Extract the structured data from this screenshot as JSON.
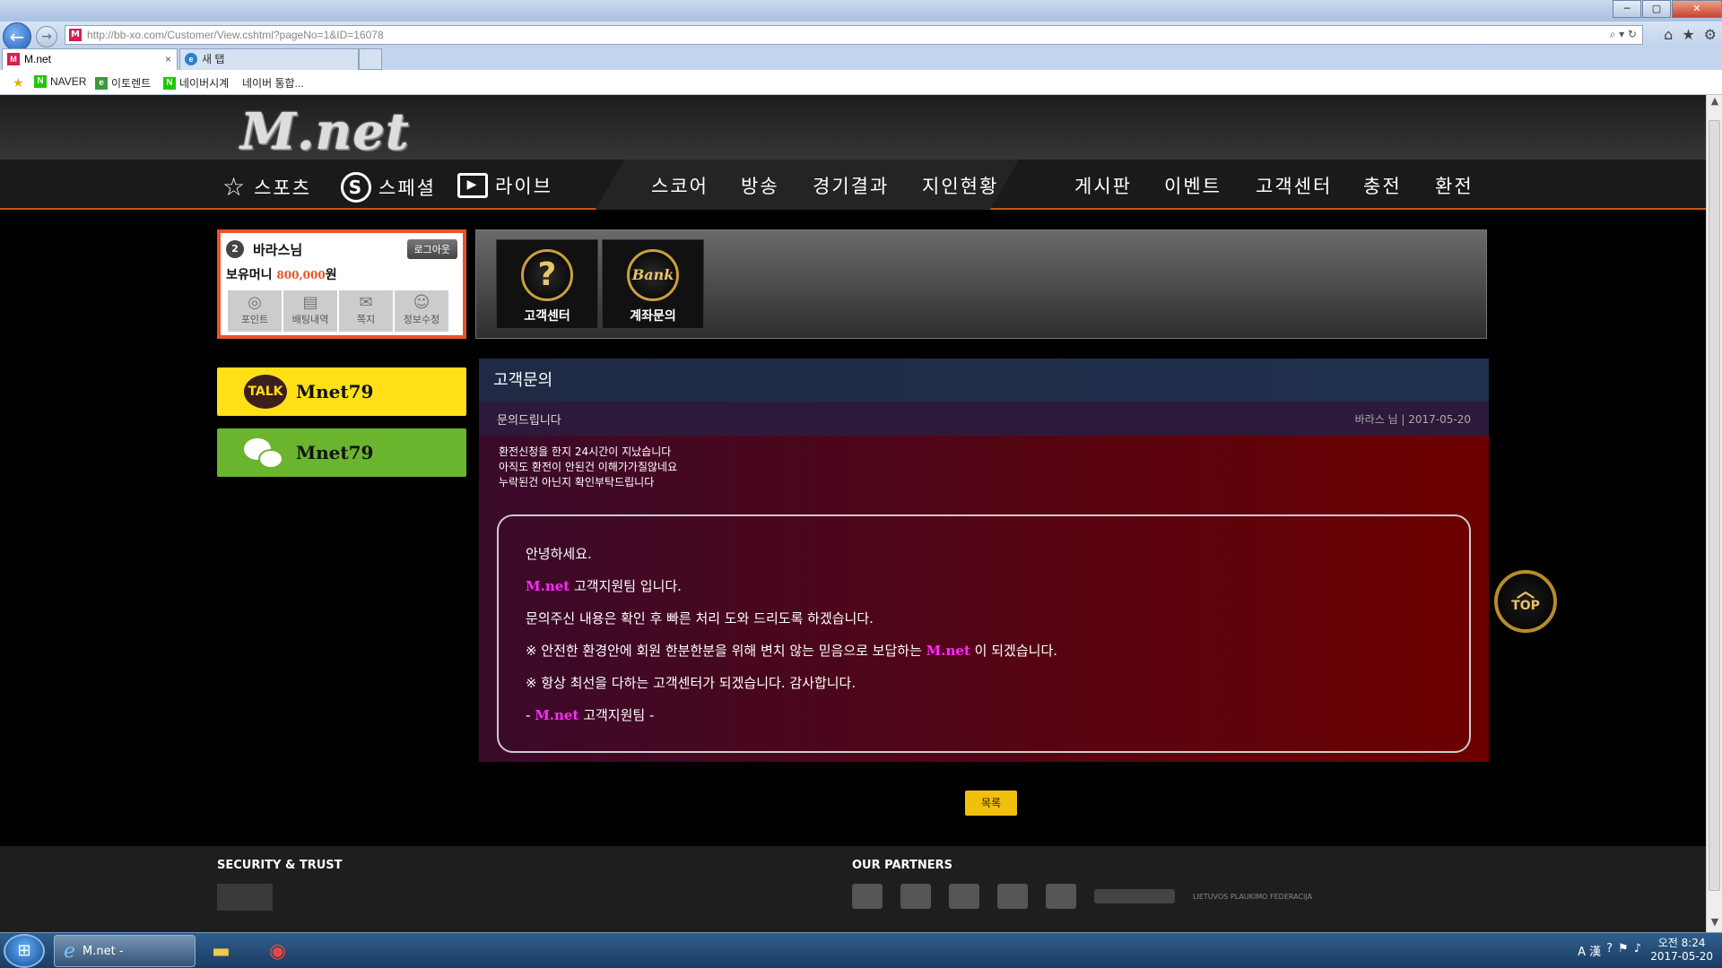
{
  "browser": {
    "url": "http://bb-xo.com/Customer/View.cshtml?pageNo=1&ID=16078",
    "tabs": [
      {
        "label": "M.net",
        "active": true
      },
      {
        "label": "새 탭",
        "active": false
      }
    ],
    "favorites": [
      "NAVER",
      "이토렌트",
      "네이버시계",
      "네이버 통합..."
    ],
    "window_buttons": [
      "─",
      "▢",
      "✕"
    ]
  },
  "site": {
    "logo": "M.net",
    "nav_left": [
      {
        "icon": "star-icon",
        "label": "스포츠"
      },
      {
        "icon": "special-s-icon",
        "label": "스페셜"
      },
      {
        "icon": "live-monitor-icon",
        "label": "라이브"
      }
    ],
    "nav_mid": [
      "스코어",
      "방송",
      "경기결과",
      "지인현황"
    ],
    "nav_right": [
      "게시판",
      "이벤트",
      "고객센터",
      "충전",
      "환전"
    ]
  },
  "user": {
    "name": "바라스님",
    "level": "2",
    "logout_label": "로그아웃",
    "money_label": "보유머니",
    "money_value": "800,000",
    "money_unit": "원",
    "buttons": [
      "포인트",
      "배팅내역",
      "쪽지",
      "정보수정"
    ]
  },
  "menu": [
    {
      "label": "고객센터",
      "glyph": "?"
    },
    {
      "label": "계좌문의",
      "glyph": "Bank"
    }
  ],
  "social": [
    {
      "icon": "kakaotalk-icon",
      "icon_text": "TALK",
      "label": "Mnet79"
    },
    {
      "icon": "wechat-icon",
      "label": "Mnet79"
    }
  ],
  "inquiry": {
    "section_title": "고객문의",
    "subject": "문의드립니다",
    "author_meta": "바라스 님 | 2017-05-20",
    "body_lines": [
      "환전신청을 한지 24시간이 지났습니다",
      "아직도 환전이 안된건 이해가가질않네요",
      "누락된건 아닌지 확인부탁드립니다"
    ],
    "answer": {
      "greeting": "안녕하세요.",
      "team_brand": "M.net",
      "team_suffix": "고객지원팀 입니다.",
      "line3": "문의주신 내용은 확인 후 빠른 처리 도와 드리도록 하겠습니다.",
      "line4_prefix": "※ 안전한 환경안에 회원 한분한분을 위해 변치 않는 믿음으로 보답하는",
      "line4_brand": "M.net",
      "line4_suffix": "이 되겠습니다.",
      "line5": "※ 항상 최선을 다하는 고객센터가 되겠습니다. 감사합니다.",
      "sign_prefix": "-",
      "sign_brand": "M.net",
      "sign_suffix": "고객지원팀 -"
    },
    "list_button": "목록"
  },
  "top_button": "TOP",
  "footer": {
    "security_title": "SECURITY & TRUST",
    "partners_title": "OUR PARTNERS",
    "partner_text": "LIETUVOS PLAUKIMO FEDERACIJA"
  },
  "taskbar": {
    "window_label": "M.net -",
    "clock_time": "오전 8:24",
    "clock_date": "2017-05-20",
    "ime": "A 漢"
  },
  "colors": {
    "accent": "#e8542a",
    "brand_text": "#ff2aff",
    "list_button": "#f2bf0c",
    "kakao": "#ffe017",
    "wechat": "#6bb42e"
  }
}
